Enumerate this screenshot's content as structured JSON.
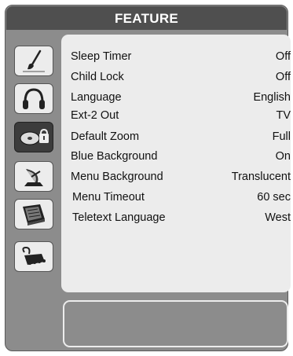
{
  "header": {
    "title": "FEATURE"
  },
  "tabs": [
    {
      "name": "picture",
      "icon": "paintbrush-icon",
      "active": false
    },
    {
      "name": "sound",
      "icon": "headphones-icon",
      "active": false
    },
    {
      "name": "feature",
      "icon": "disc-lock-icon",
      "active": true
    },
    {
      "name": "install",
      "icon": "satellite-dish-icon",
      "active": false
    },
    {
      "name": "teletext",
      "icon": "book-icon",
      "active": false
    },
    {
      "name": "source",
      "icon": "scart-connector-icon",
      "active": false
    }
  ],
  "menu": {
    "items": [
      {
        "label": "Sleep Timer",
        "value": "Off"
      },
      {
        "label": "Child Lock",
        "value": "Off"
      },
      {
        "label": "Language",
        "value": "English"
      },
      {
        "label": "Ext-2 Out",
        "value": "TV"
      },
      {
        "label": "Default Zoom",
        "value": "Full"
      },
      {
        "label": "Blue Background",
        "value": "On"
      },
      {
        "label": "Menu Background",
        "value": "Translucent"
      },
      {
        "label": "Menu Timeout",
        "value": "60 sec"
      },
      {
        "label": "Teletext Language",
        "value": "West"
      }
    ]
  },
  "colors": {
    "frame": "#8c8c8c",
    "header": "#4f4f4f",
    "panel": "#ececec",
    "active_tab": "#3c3c3c"
  }
}
